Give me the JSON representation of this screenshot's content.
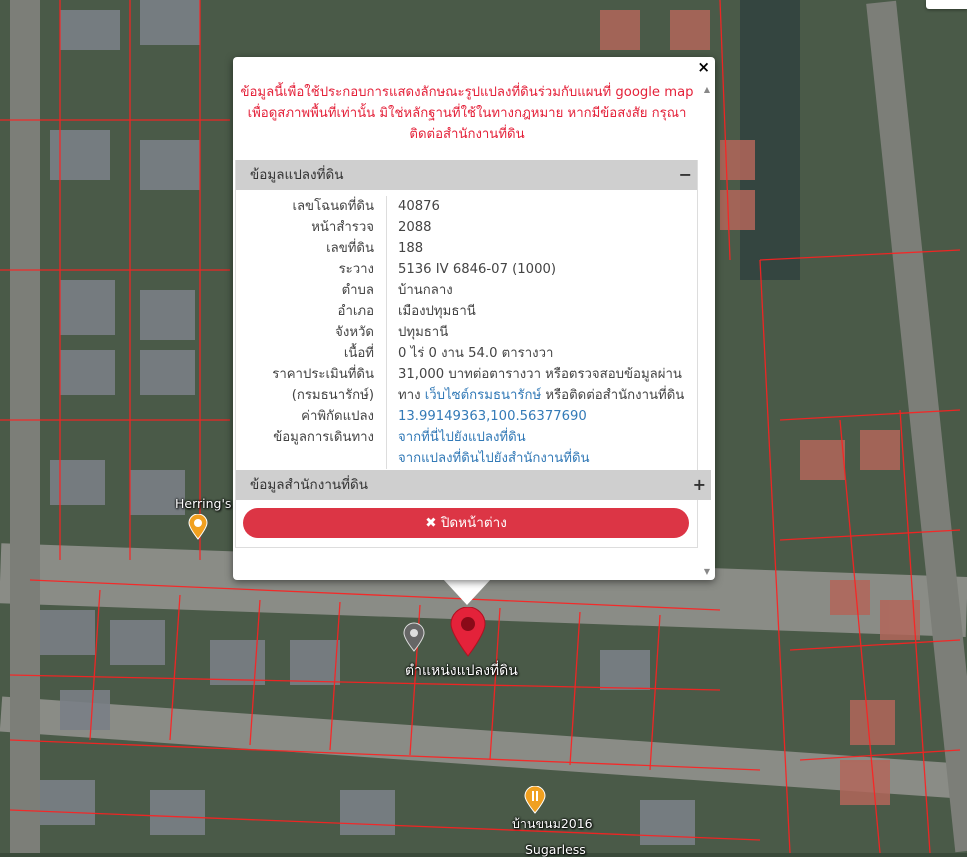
{
  "disclaimer": "ข้อมูลนี้เพื่อใช้ประกอบการแสดงลักษณะรูปแปลงที่ดินร่วมกับแผนที่ google map เพื่อดูสภาพพื้นที่เท่านั้น มิใช่หลักฐานที่ใช้ในทางกฎหมาย หากมีข้อสงสัย กรุณาติดต่อสำนักงานที่ดิน",
  "close_icon": "×",
  "panel1": {
    "title": "ข้อมูลแปลงที่ดิน",
    "toggle": "−",
    "rows": [
      {
        "label": "เลขโฉนดที่ดิน",
        "value": "40876"
      },
      {
        "label": "หน้าสำรวจ",
        "value": "2088"
      },
      {
        "label": "เลขที่ดิน",
        "value": "188"
      },
      {
        "label": "ระวาง",
        "value": "5136 IV 6846-07 (1000)"
      },
      {
        "label": "ตำบล",
        "value": "บ้านกลาง"
      },
      {
        "label": "อำเภอ",
        "value": "เมืองปทุมธานี"
      },
      {
        "label": "จังหวัด",
        "value": "ปทุมธานี"
      },
      {
        "label": "เนื้อที่",
        "value": "0 ไร่ 0 งาน 54.0 ตารางวา"
      },
      {
        "label": "ราคาประเมินที่ดิน",
        "value": "31,000 บาทต่อตารางวา หรือตรวจสอบข้อมูลผ่าน"
      }
    ],
    "price_note_label": "(กรมธนารักษ์)",
    "price_note_prefix": "ทาง",
    "price_note_link": "เว็บไซต์กรมธนารักษ์",
    "price_note_suffix": "หรือติดต่อสำนักงานที่ดิน",
    "coord_label": "ค่าพิกัดแปลง",
    "coord_value": "13.99149363,100.56377690",
    "route_label": "ข้อมูลการเดินทาง",
    "route_link_1": "จากที่นี่ไปยังแปลงที่ดิน",
    "route_link_2": "จากแปลงที่ดินไปยังสำนักงานที่ดิน"
  },
  "panel2": {
    "title": "ข้อมูลสำนักงานที่ดิน",
    "toggle": "+"
  },
  "close_button": {
    "icon": "✖",
    "label": "ปิดหน้าต่าง"
  },
  "map": {
    "marker_label": "ตำแหน่งแปลงที่ดิน",
    "poi_1": "Herring's",
    "poi_2": "บ้านขนม2016",
    "poi_3": "Sugarless",
    "marker_color": "#e4223a",
    "poi_icon": "food-icon",
    "poi_color": "#f0a020"
  }
}
